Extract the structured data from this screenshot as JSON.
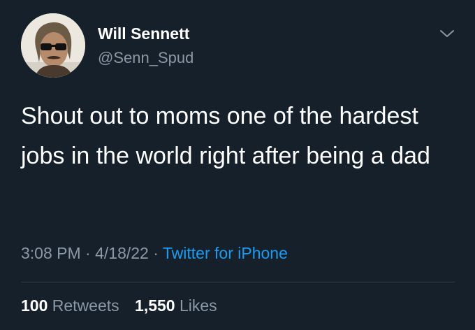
{
  "author": {
    "display_name": "Will Sennett",
    "handle": "@Senn_Spud",
    "avatar_icon": "profile-photo"
  },
  "tweet": {
    "text": "Shout out to moms one of the hardest jobs in the world right after being a dad"
  },
  "meta": {
    "time": "3:08 PM",
    "separator1": " · ",
    "date": "4/18/22",
    "separator2": " · ",
    "source": "Twitter for iPhone"
  },
  "stats": {
    "retweets_count": "100",
    "retweets_label": "Retweets",
    "likes_count": "1,550",
    "likes_label": "Likes"
  },
  "menu_icon": "chevron-down-icon",
  "colors": {
    "background": "#15202b",
    "primary_text": "#ffffff",
    "secondary_text": "#8b98a5",
    "link": "#1d9bf0",
    "divider": "#2f3b47"
  }
}
